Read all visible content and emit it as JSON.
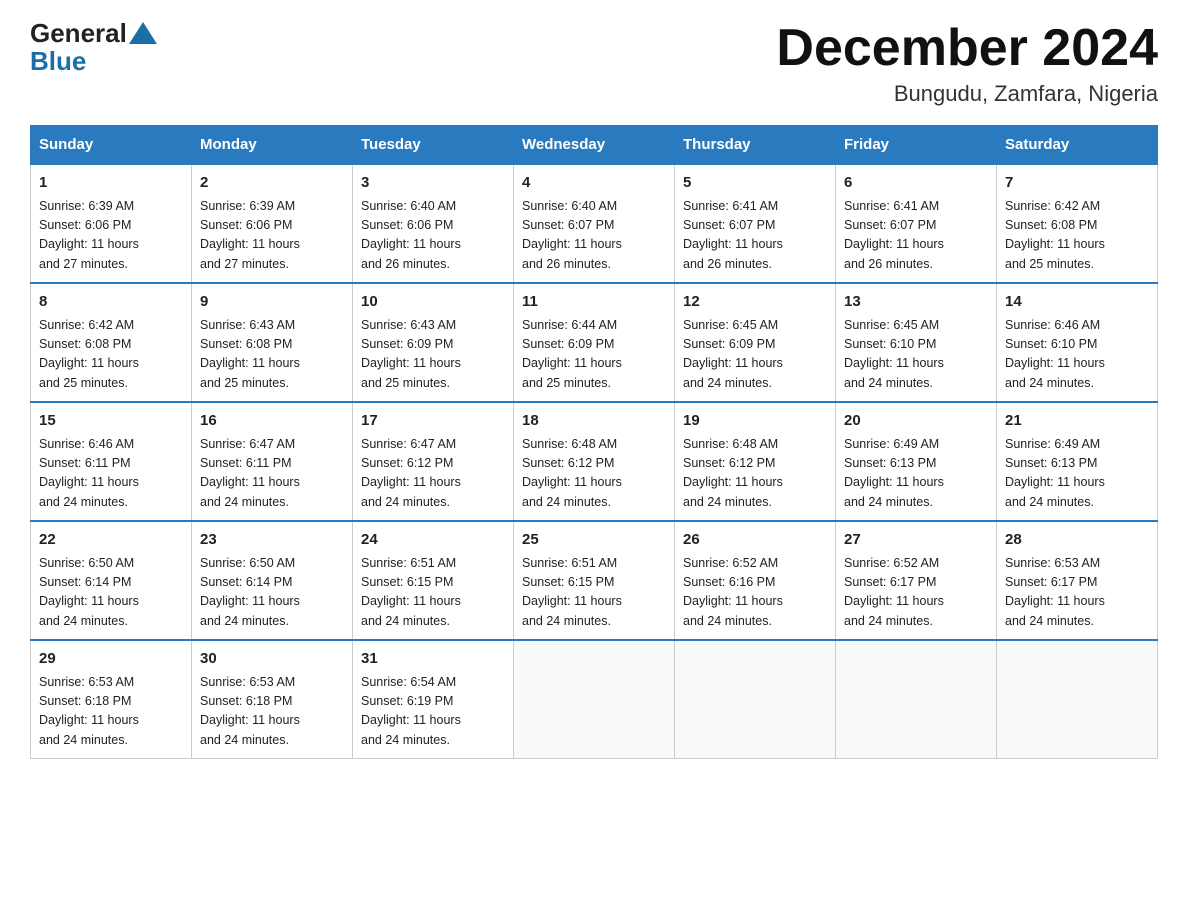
{
  "header": {
    "logo_general": "General",
    "logo_blue": "Blue",
    "month_title": "December 2024",
    "location": "Bungudu, Zamfara, Nigeria"
  },
  "weekdays": [
    "Sunday",
    "Monday",
    "Tuesday",
    "Wednesday",
    "Thursday",
    "Friday",
    "Saturday"
  ],
  "weeks": [
    [
      {
        "day": "1",
        "sunrise": "6:39 AM",
        "sunset": "6:06 PM",
        "daylight": "11 hours and 27 minutes."
      },
      {
        "day": "2",
        "sunrise": "6:39 AM",
        "sunset": "6:06 PM",
        "daylight": "11 hours and 27 minutes."
      },
      {
        "day": "3",
        "sunrise": "6:40 AM",
        "sunset": "6:06 PM",
        "daylight": "11 hours and 26 minutes."
      },
      {
        "day": "4",
        "sunrise": "6:40 AM",
        "sunset": "6:07 PM",
        "daylight": "11 hours and 26 minutes."
      },
      {
        "day": "5",
        "sunrise": "6:41 AM",
        "sunset": "6:07 PM",
        "daylight": "11 hours and 26 minutes."
      },
      {
        "day": "6",
        "sunrise": "6:41 AM",
        "sunset": "6:07 PM",
        "daylight": "11 hours and 26 minutes."
      },
      {
        "day": "7",
        "sunrise": "6:42 AM",
        "sunset": "6:08 PM",
        "daylight": "11 hours and 25 minutes."
      }
    ],
    [
      {
        "day": "8",
        "sunrise": "6:42 AM",
        "sunset": "6:08 PM",
        "daylight": "11 hours and 25 minutes."
      },
      {
        "day": "9",
        "sunrise": "6:43 AM",
        "sunset": "6:08 PM",
        "daylight": "11 hours and 25 minutes."
      },
      {
        "day": "10",
        "sunrise": "6:43 AM",
        "sunset": "6:09 PM",
        "daylight": "11 hours and 25 minutes."
      },
      {
        "day": "11",
        "sunrise": "6:44 AM",
        "sunset": "6:09 PM",
        "daylight": "11 hours and 25 minutes."
      },
      {
        "day": "12",
        "sunrise": "6:45 AM",
        "sunset": "6:09 PM",
        "daylight": "11 hours and 24 minutes."
      },
      {
        "day": "13",
        "sunrise": "6:45 AM",
        "sunset": "6:10 PM",
        "daylight": "11 hours and 24 minutes."
      },
      {
        "day": "14",
        "sunrise": "6:46 AM",
        "sunset": "6:10 PM",
        "daylight": "11 hours and 24 minutes."
      }
    ],
    [
      {
        "day": "15",
        "sunrise": "6:46 AM",
        "sunset": "6:11 PM",
        "daylight": "11 hours and 24 minutes."
      },
      {
        "day": "16",
        "sunrise": "6:47 AM",
        "sunset": "6:11 PM",
        "daylight": "11 hours and 24 minutes."
      },
      {
        "day": "17",
        "sunrise": "6:47 AM",
        "sunset": "6:12 PM",
        "daylight": "11 hours and 24 minutes."
      },
      {
        "day": "18",
        "sunrise": "6:48 AM",
        "sunset": "6:12 PM",
        "daylight": "11 hours and 24 minutes."
      },
      {
        "day": "19",
        "sunrise": "6:48 AM",
        "sunset": "6:12 PM",
        "daylight": "11 hours and 24 minutes."
      },
      {
        "day": "20",
        "sunrise": "6:49 AM",
        "sunset": "6:13 PM",
        "daylight": "11 hours and 24 minutes."
      },
      {
        "day": "21",
        "sunrise": "6:49 AM",
        "sunset": "6:13 PM",
        "daylight": "11 hours and 24 minutes."
      }
    ],
    [
      {
        "day": "22",
        "sunrise": "6:50 AM",
        "sunset": "6:14 PM",
        "daylight": "11 hours and 24 minutes."
      },
      {
        "day": "23",
        "sunrise": "6:50 AM",
        "sunset": "6:14 PM",
        "daylight": "11 hours and 24 minutes."
      },
      {
        "day": "24",
        "sunrise": "6:51 AM",
        "sunset": "6:15 PM",
        "daylight": "11 hours and 24 minutes."
      },
      {
        "day": "25",
        "sunrise": "6:51 AM",
        "sunset": "6:15 PM",
        "daylight": "11 hours and 24 minutes."
      },
      {
        "day": "26",
        "sunrise": "6:52 AM",
        "sunset": "6:16 PM",
        "daylight": "11 hours and 24 minutes."
      },
      {
        "day": "27",
        "sunrise": "6:52 AM",
        "sunset": "6:17 PM",
        "daylight": "11 hours and 24 minutes."
      },
      {
        "day": "28",
        "sunrise": "6:53 AM",
        "sunset": "6:17 PM",
        "daylight": "11 hours and 24 minutes."
      }
    ],
    [
      {
        "day": "29",
        "sunrise": "6:53 AM",
        "sunset": "6:18 PM",
        "daylight": "11 hours and 24 minutes."
      },
      {
        "day": "30",
        "sunrise": "6:53 AM",
        "sunset": "6:18 PM",
        "daylight": "11 hours and 24 minutes."
      },
      {
        "day": "31",
        "sunrise": "6:54 AM",
        "sunset": "6:19 PM",
        "daylight": "11 hours and 24 minutes."
      },
      null,
      null,
      null,
      null
    ]
  ],
  "labels": {
    "sunrise": "Sunrise:",
    "sunset": "Sunset:",
    "daylight": "Daylight:"
  }
}
